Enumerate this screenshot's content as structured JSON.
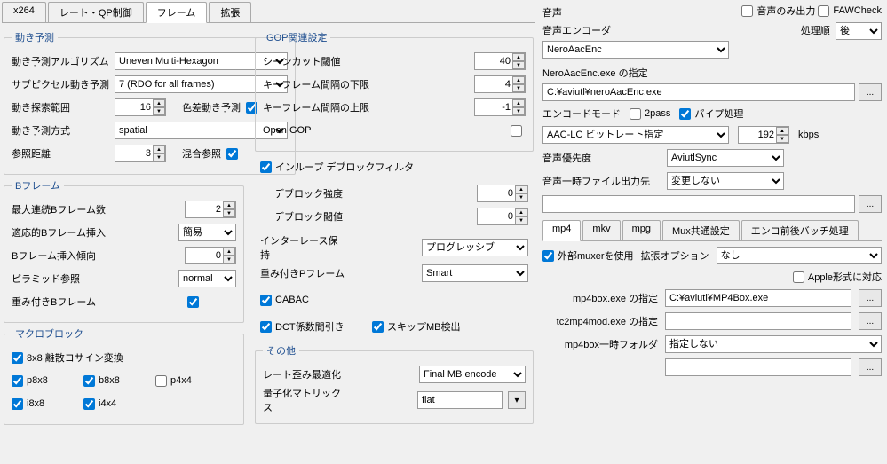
{
  "tabs": {
    "x264": "x264",
    "rateQp": "レート・QP制御",
    "frame": "フレーム",
    "ext": "拡張"
  },
  "motion": {
    "legend": "動き予測",
    "algo": {
      "label": "動き予測アルゴリズム",
      "value": "Uneven Multi-Hexagon"
    },
    "subpixel": {
      "label": "サブピクセル動き予測",
      "value": "7 (RDO for all frames)"
    },
    "range": {
      "label": "動き探索範囲",
      "value": "16"
    },
    "chroma": {
      "label": "色差動き予測"
    },
    "method": {
      "label": "動き予測方式",
      "value": "spatial"
    },
    "refDist": {
      "label": "参照距離",
      "value": "3"
    },
    "mixRef": {
      "label": "混合参照"
    }
  },
  "bframe": {
    "legend": "Bフレーム",
    "max": {
      "label": "最大連続Bフレーム数",
      "value": "2"
    },
    "adapt": {
      "label": "適応的Bフレーム挿入",
      "value": "簡易"
    },
    "bias": {
      "label": "Bフレーム挿入傾向",
      "value": "0"
    },
    "pyramid": {
      "label": "ピラミッド参照",
      "value": "normal"
    },
    "weighted": {
      "label": "重み付きBフレーム"
    }
  },
  "gop": {
    "legend": "GOP関連設定",
    "scenecut": {
      "label": "シーンカット閾値",
      "value": "40"
    },
    "keymin": {
      "label": "キーフレーム間隔の下限",
      "value": "4"
    },
    "keymax": {
      "label": "キーフレーム間隔の上限",
      "value": "-1"
    },
    "opengop": {
      "label": "Open GOP"
    }
  },
  "deblock": {
    "inloop": "インループ デブロックフィルタ",
    "strength": {
      "label": "デブロック強度",
      "value": "0"
    },
    "threshold": {
      "label": "デブロック閾値",
      "value": "0"
    }
  },
  "interlace": {
    "label": "インターレース保持",
    "value": "プログレッシブ"
  },
  "weightedP": {
    "label": "重み付きPフレーム",
    "value": "Smart"
  },
  "cabac": "CABAC",
  "dct": "DCT係数間引き",
  "skipmb": "スキップMB検出",
  "macro": {
    "legend": "マクロブロック",
    "dct8": "8x8 離散コサイン変換",
    "p8": "p8x8",
    "b8": "b8x8",
    "p4": "p4x4",
    "i8": "i8x8",
    "i4": "i4x4"
  },
  "other": {
    "legend": "その他",
    "rate": {
      "label": "レート歪み最適化",
      "value": "Final MB encode"
    },
    "matrix": {
      "label": "量子化マトリックス",
      "value": "flat"
    }
  },
  "audio": {
    "legend": "音声",
    "onlyAudio": "音声のみ出力",
    "fawCheck": "FAWCheck",
    "encoder": "音声エンコーダ",
    "encoderVal": "NeroAacEnc",
    "order": "処理順",
    "orderVal": "後",
    "neroPath": "NeroAacEnc.exe の指定",
    "neroVal": "C:¥aviutl¥neroAacEnc.exe",
    "encMode": "エンコードモード",
    "twopass": "2pass",
    "pipe": "パイプ処理",
    "modeVal": "AAC-LC ビットレート指定",
    "bitrate": "192",
    "kbps": "kbps",
    "priority": "音声優先度",
    "priorityVal": "AviutlSync",
    "tmpOut": "音声一時ファイル出力先",
    "tmpVal": "変更しない"
  },
  "mux": {
    "tabs": {
      "mp4": "mp4",
      "mkv": "mkv",
      "mpg": "mpg",
      "common": "Mux共通設定",
      "batch": "エンコ前後バッチ処理"
    },
    "extMuxer": "外部muxerを使用",
    "extOpt": "拡張オプション",
    "extOptVal": "なし",
    "apple": "Apple形式に対応",
    "mp4box": "mp4box.exe の指定",
    "mp4boxVal": "C:¥aviutl¥MP4Box.exe",
    "tc2": "tc2mp4mod.exe の指定",
    "tmpFolder": "mp4box一時フォルダ",
    "tmpFolderVal": "指定しない",
    "dots": "..."
  }
}
